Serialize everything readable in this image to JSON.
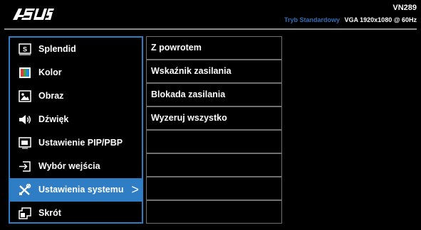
{
  "header": {
    "logo": "ASUS",
    "model": "VN289",
    "mode": "Tryb Standardowy",
    "signal": "VGA  1920x1080 @ 60Hz"
  },
  "colors": {
    "accent": "#2f7ec5",
    "mode_text": "#2e6db8",
    "background": "#000000"
  },
  "main_menu": [
    {
      "label": "Splendid",
      "icon": "splendid-icon"
    },
    {
      "label": "Kolor",
      "icon": "color-icon"
    },
    {
      "label": "Obraz",
      "icon": "image-icon"
    },
    {
      "label": "Dźwięk",
      "icon": "speaker-icon"
    },
    {
      "label": "Ustawienie PIP/PBP",
      "icon": "pip-icon"
    },
    {
      "label": "Wybór wejścia",
      "icon": "input-select-icon"
    },
    {
      "label": "Ustawienia systemu",
      "icon": "system-settings-icon",
      "selected": true,
      "arrow": ">"
    },
    {
      "label": "Skrót",
      "icon": "shortcut-icon"
    }
  ],
  "sub_menu": [
    {
      "label": "Z powrotem"
    },
    {
      "label": "Wskaźnik zasilania"
    },
    {
      "label": "Blokada zasilania"
    },
    {
      "label": "Wyzeruj wszystko"
    },
    {
      "label": ""
    },
    {
      "label": ""
    },
    {
      "label": ""
    },
    {
      "label": ""
    }
  ]
}
